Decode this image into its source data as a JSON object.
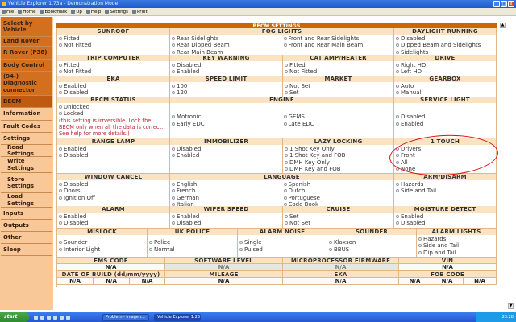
{
  "window": {
    "title": "Vehicle Explorer 1.73a - Demonstration Mode"
  },
  "toolbar": [
    "File",
    "Home",
    "Bookmark",
    "Up",
    "Help",
    "Settings",
    "Print"
  ],
  "sidebar": [
    {
      "label": "Select by Vehicle",
      "style": "dark"
    },
    {
      "label": "Land Rover",
      "style": "dark"
    },
    {
      "label": "R Rover (P38)",
      "style": "dark"
    },
    {
      "label": "Body Control",
      "style": "dark"
    },
    {
      "label": "(94-) Diagnostic connector",
      "style": "dark"
    },
    {
      "label": "BECM",
      "style": "active"
    },
    {
      "label": "Information",
      "style": "light"
    },
    {
      "label": "Fault Codes",
      "style": "light"
    },
    {
      "label": "Settings",
      "style": "light"
    },
    {
      "label": "Read Settings",
      "style": "light sub"
    },
    {
      "label": "Write Settings",
      "style": "light sub"
    },
    {
      "label": "Store Settings",
      "style": "light sub"
    },
    {
      "label": "Load Settings",
      "style": "light sub"
    },
    {
      "label": "Inputs",
      "style": "light"
    },
    {
      "label": "Outputs",
      "style": "light"
    },
    {
      "label": "Other",
      "style": "light"
    },
    {
      "label": "Sleep",
      "style": "light"
    }
  ],
  "main": {
    "title": "BECM SETTINGS",
    "rows": [
      [
        {
          "title": "SUNROOF",
          "cols": [
            [
              "Fitted",
              "Not Fitted"
            ]
          ]
        },
        {
          "title": "FOG LIGHTS",
          "span": 2,
          "cols": [
            [
              "Rear Sidelights",
              "Rear Dipped Beam",
              "Rear Main Beam"
            ],
            [
              "Front and Rear Sidelights",
              "Front and Rear Main Beam"
            ]
          ]
        },
        {
          "title": "DAYLIGHT RUNNING",
          "cols": [
            [
              "Disabled",
              "Dipped Beam and Sidelights",
              "Sidelights"
            ]
          ]
        }
      ],
      [
        {
          "title": "TRIP COMPUTER",
          "cols": [
            [
              "Fitted",
              "Not Fitted"
            ]
          ]
        },
        {
          "title": "KEY WARNING",
          "cols": [
            [
              "Disabled",
              "Enabled"
            ]
          ]
        },
        {
          "title": "CAT AMP/HEATER",
          "cols": [
            [
              "Fitted",
              "Not Fitted"
            ]
          ]
        },
        {
          "title": "DRIVE",
          "cols": [
            [
              "Right HD",
              "Left HD"
            ]
          ]
        }
      ],
      [
        {
          "title": "EKA",
          "cols": [
            [
              "Enabled",
              "Disabled"
            ]
          ]
        },
        {
          "title": "SPEED LIMIT",
          "cols": [
            [
              "100",
              "120"
            ]
          ]
        },
        {
          "title": "MARKET",
          "cols": [
            [
              "Not Set",
              "Set"
            ]
          ]
        },
        {
          "title": "GEARBOX",
          "cols": [
            [
              "Auto",
              "Manual"
            ]
          ]
        }
      ],
      [
        {
          "title": "BECM STATUS",
          "cols": [
            [
              "Unlocked",
              "Locked"
            ]
          ],
          "note": "(this setting is irrversible. Lock the BECM only when all the data is correct. See help for more details.)"
        },
        {
          "title": "ENGINE",
          "span": 2,
          "center": true,
          "cols": [
            [
              "Motronic",
              "Early EDC"
            ],
            [
              "GEMS",
              "Late EDC"
            ]
          ]
        },
        {
          "title": "SERVICE LIGHT",
          "center": true,
          "cols": [
            [
              "Disabled",
              "Enabled"
            ]
          ]
        }
      ],
      [
        {
          "title": "RANGE LAMP",
          "cols": [
            [
              "Enabled",
              "Disabled"
            ]
          ]
        },
        {
          "title": "IMMOBILIZER",
          "cols": [
            [
              "Disabled",
              "Enabled"
            ]
          ]
        },
        {
          "title": "LAZY LOCKING",
          "cols": [
            [
              "1 Shot Key Only",
              "1 Shot Key and FOB",
              "DMH Key Only",
              "DMH Key and FOB"
            ]
          ]
        },
        {
          "title": "1 TOUCH",
          "cols": [
            [
              "Drivers",
              "Front",
              "All",
              "None"
            ]
          ]
        }
      ],
      [
        {
          "title": "WINDOW CANCEL",
          "cols": [
            [
              "Disabled",
              "Doors",
              "Ignition Off"
            ]
          ]
        },
        {
          "title": "LANGUAGE",
          "span": 2,
          "cols": [
            [
              "English",
              "French",
              "German",
              "Italian"
            ],
            [
              "Spanish",
              "Dutch",
              "Portuguese",
              "Code Book"
            ]
          ]
        },
        {
          "title": "ARM/DISARM",
          "cols": [
            [
              "Hazards",
              "Side and Tail"
            ]
          ]
        }
      ],
      [
        {
          "title": "ALARM",
          "cols": [
            [
              "Enabled",
              "Disabled"
            ]
          ]
        },
        {
          "title": "WIPER SPEED",
          "cols": [
            [
              "Enabled",
              "Disabled"
            ]
          ]
        },
        {
          "title": "CRUISE",
          "cols": [
            [
              "Set",
              "Not Set"
            ]
          ]
        },
        {
          "title": "MOISTURE DETECT",
          "cols": [
            [
              "Enabled",
              "Disabled"
            ]
          ]
        }
      ],
      [
        {
          "title": "MISLOCK",
          "center": true,
          "cols": [
            [
              "Sounder",
              "Interior Light"
            ]
          ]
        },
        {
          "title": "UK POLICE",
          "center": true,
          "cols": [
            [
              "Police",
              "Normal"
            ]
          ]
        },
        {
          "title": "ALARM NOISE",
          "center": true,
          "cols": [
            [
              "Single",
              "Pulsed"
            ]
          ]
        },
        {
          "title": "SOUNDER",
          "center": true,
          "cols": [
            [
              "Klaxson",
              "BBUS"
            ]
          ]
        },
        {
          "title": "ALARM LIGHTS",
          "cols": [
            [
              "Hazards",
              "Side and Tail",
              "Dip and Tail"
            ]
          ]
        }
      ]
    ],
    "info": [
      {
        "headers": [
          "EMS CODE",
          "SOFTWARE LEVEL",
          "MICROPROCESSOR FIRMWARE",
          "VIN"
        ],
        "values": [
          "N/A",
          "N/A",
          "N/A",
          "N/A"
        ]
      },
      {
        "headers": [
          "DATE OF BUILD (dd/mm/yyyy)",
          "MILEAGE",
          "EKA",
          "FOB CODE"
        ],
        "values": [
          "N/A",
          "N/A",
          "N/A",
          "N/A",
          "N/A",
          "N/A",
          "N/A",
          "N/A"
        ]
      }
    ]
  },
  "taskbar": {
    "start": "start",
    "tasks": [
      "Problem - imagen...",
      "Vehicle Explorer 1.23..."
    ],
    "clock": "23:28"
  },
  "colors": {
    "accent": "#cc6600",
    "header": "#fbe2c0",
    "sidebar": "#f8c898",
    "annotation": "#d81010"
  }
}
